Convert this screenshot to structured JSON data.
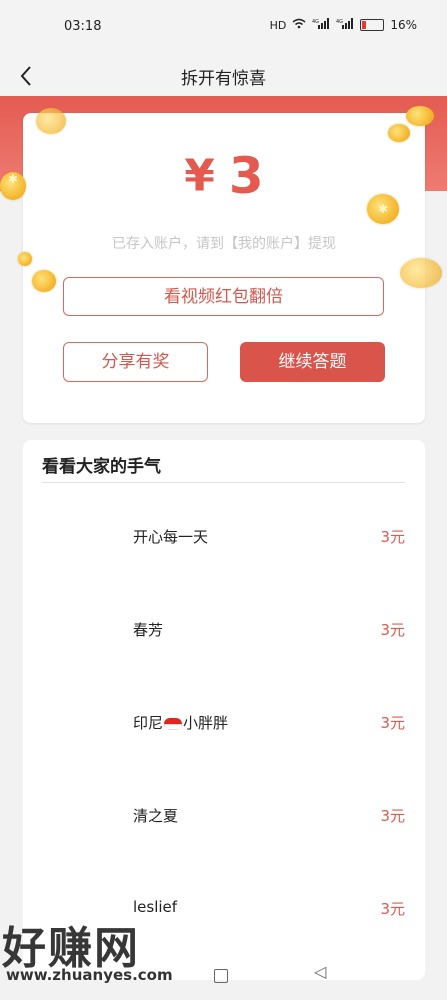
{
  "status_bar": {
    "time": "03:18",
    "signal_labels": [
      "HD",
      "WiFi",
      "4G",
      "4G"
    ],
    "battery": "16%"
  },
  "nav": {
    "title": "拆开有惊喜",
    "back_icon": "chevron-left-icon"
  },
  "prize": {
    "currency": "¥",
    "amount": "3",
    "tip": "已存入账户，请到【我的账户】提现",
    "double_button": "看视频红包翻倍",
    "share_button": "分享有奖",
    "continue_button": "继续答题"
  },
  "winners": {
    "title": "看看大家的手气",
    "items": [
      {
        "name": "开心每一天",
        "amount": "3元"
      },
      {
        "name": "春芳",
        "amount": "3元"
      },
      {
        "name_before": "印尼",
        "name_after": "小胖胖",
        "amount": "3元"
      },
      {
        "name": "清之夏",
        "amount": "3元"
      },
      {
        "name": "leslief",
        "amount": "3元"
      }
    ]
  },
  "watermark": {
    "text": "好赚网",
    "url": "www.zhuanyes.com"
  },
  "colors": {
    "accent": "#d9544b",
    "amount_red": "#e55a4f",
    "band_red": "#e45b52"
  }
}
